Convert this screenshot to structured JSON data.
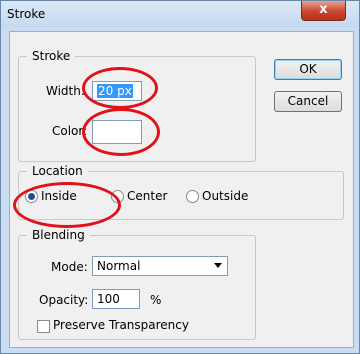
{
  "window": {
    "title": "Stroke",
    "close_glyph": "x"
  },
  "stroke_group": {
    "legend": "Stroke",
    "width_label": "Width:",
    "width_value": "20 px",
    "color_label": "Color:",
    "color_swatch": "#ffffff"
  },
  "buttons": {
    "ok": "OK",
    "cancel": "Cancel"
  },
  "location_group": {
    "legend": "Location",
    "options": [
      "Inside",
      "Center",
      "Outside"
    ],
    "selected": "Inside"
  },
  "blending_group": {
    "legend": "Blending",
    "mode_label": "Mode:",
    "mode_value": "Normal",
    "opacity_label": "Opacity:",
    "opacity_value": "100",
    "opacity_unit": "%",
    "preserve_label": "Preserve Transparency",
    "preserve_checked": false
  },
  "annotations": {
    "highlight_color": "#e0121b"
  }
}
